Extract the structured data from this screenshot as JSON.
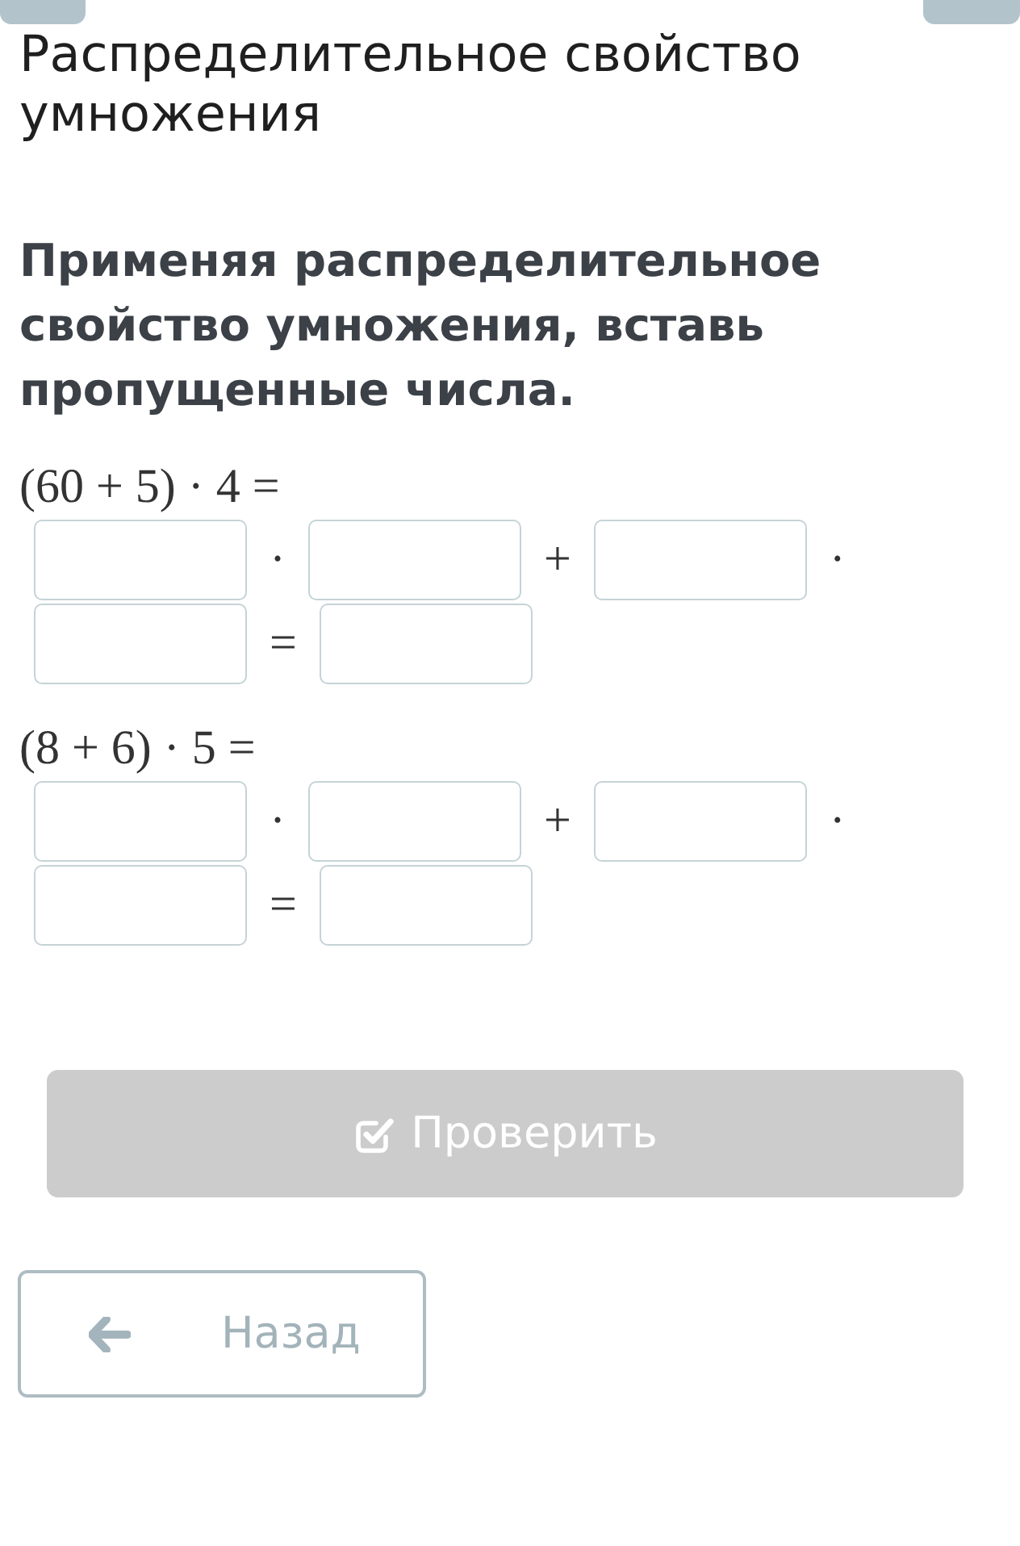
{
  "header_title": "Распределительное свойство умножения",
  "task": {
    "prompt": "Применяя распределительное свойство умножения, вставь пропущенные числа."
  },
  "problems": [
    {
      "expression": "(60 + 5) · 4 =",
      "parts": [
        {
          "kind": "field"
        },
        {
          "kind": "operator",
          "text": "·"
        },
        {
          "kind": "field"
        },
        {
          "kind": "operator",
          "text": "+"
        },
        {
          "kind": "field"
        },
        {
          "kind": "operator",
          "text": "·"
        },
        {
          "kind": "field"
        },
        {
          "kind": "operator",
          "text": "="
        },
        {
          "kind": "field"
        }
      ]
    },
    {
      "expression": "(8 + 6) · 5 =",
      "parts": [
        {
          "kind": "field"
        },
        {
          "kind": "operator",
          "text": "·"
        },
        {
          "kind": "field"
        },
        {
          "kind": "operator",
          "text": "+"
        },
        {
          "kind": "field"
        },
        {
          "kind": "operator",
          "text": "·"
        },
        {
          "kind": "field"
        },
        {
          "kind": "operator",
          "text": "="
        },
        {
          "kind": "field"
        }
      ]
    }
  ],
  "check_button": {
    "label": "Проверить",
    "disabled": true
  },
  "back_button": {
    "label": "Назад"
  }
}
